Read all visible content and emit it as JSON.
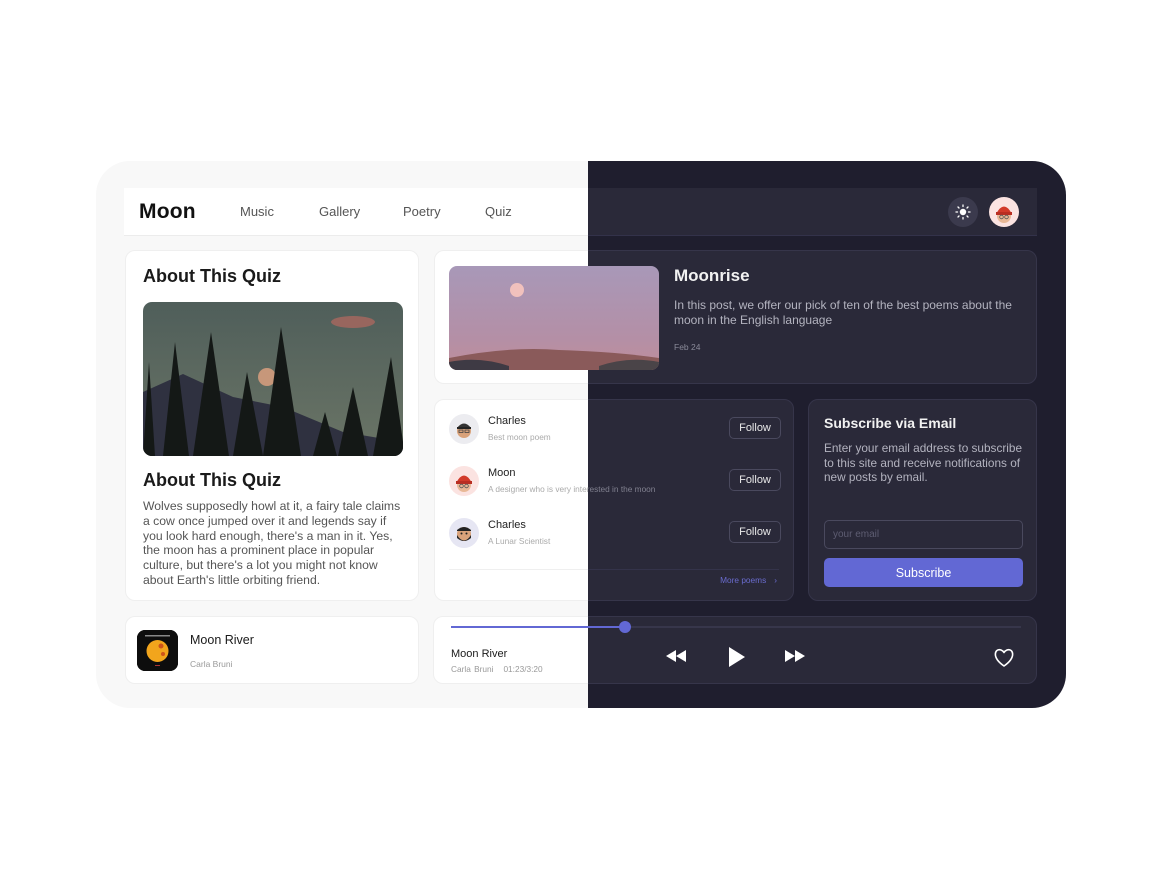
{
  "nav": {
    "logo": "Moon",
    "links": [
      "Music",
      "Gallery",
      "Poetry",
      "Quiz"
    ],
    "theme_toggle_icon": "sun-icon",
    "avatar_icon": "user-avatar-red-hat"
  },
  "quiz": {
    "title": "About This Quiz",
    "image_alt": "Moon rising behind pine trees and mountains",
    "subtitle": "About This Quiz",
    "text": "Wolves supposedly howl at it, a fairy tale claims a cow once jumped over it and legends say if you look hard enough, there's a man in it. Yes, the moon has a prominent place in popular culture, but there's a lot you might not know about Earth's little orbiting friend."
  },
  "post": {
    "image_alt": "Pink moon over a hill at dusk",
    "title": "Moonrise",
    "text": "In this post, we offer our pick of ten of the best poems about the moon in the English language",
    "date": "Feb 24"
  },
  "people": {
    "items": [
      {
        "name": "Charles",
        "desc": "Best moon poem",
        "avatar": "avatar-cap-glasses",
        "follow_label": "Follow"
      },
      {
        "name": "Moon",
        "desc": "A designer who is very interested in the moon",
        "avatar": "avatar-red-hat",
        "follow_label": "Follow"
      },
      {
        "name": "Charles",
        "desc": "A Lunar Scientist",
        "avatar": "avatar-beard",
        "follow_label": "Follow"
      }
    ],
    "more_label": "More poems",
    "more_icon": "chevron-right-icon"
  },
  "subscribe": {
    "title": "Subscribe via Email",
    "text": "Enter your email address to subscribe to this site and receive notifications of new posts by email.",
    "input_placeholder": "your email",
    "input_value": "",
    "button_label": "Subscribe"
  },
  "song": {
    "title": "Moon River",
    "artist": "Carla Bruni",
    "art_icon": "album-art-moon"
  },
  "player": {
    "title": "Moon River",
    "artist": "Carla Bruni",
    "time": "01:23/3:20",
    "progress": 0.305,
    "accent_color": "#6268d4",
    "controls": [
      "rewind-icon",
      "play-icon",
      "fast-forward-icon",
      "heart-icon"
    ]
  },
  "themes": {
    "light_bg": "#f8f8f8",
    "dark_bg": "#1f1e2e",
    "accent": "#6268d4"
  }
}
